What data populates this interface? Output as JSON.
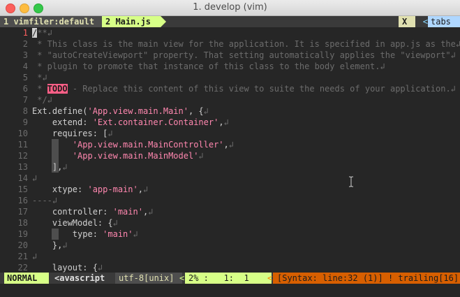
{
  "window": {
    "title": "1. develop (vim)"
  },
  "tabline": {
    "tab1": "1 vimfiler:default",
    "tab2": "2 Main.js",
    "close": "X",
    "sep": "<",
    "tabs": "tabs"
  },
  "editor": {
    "lines": [
      {
        "n": "1",
        "t": "/**↲"
      },
      {
        "n": "2",
        "t": " * This class is the main view for the application. It is specified in app.js as the↲"
      },
      {
        "n": "3",
        "t": " * \"autoCreateViewport\" property. That setting automatically applies the \"viewport\"↲"
      },
      {
        "n": "4",
        "t": " * plugin to promote that instance of this class to the body element.↲"
      },
      {
        "n": "5",
        "t": " *↲"
      },
      {
        "n": "6",
        "t": " * TODO - Replace this content of this view to suite the needs of your application.↲"
      },
      {
        "n": "7",
        "t": " */↲"
      },
      {
        "n": "8",
        "t": "Ext.define('App.view.main.Main', {↲"
      },
      {
        "n": "9",
        "t": "    extend: 'Ext.container.Container',↲"
      },
      {
        "n": "10",
        "t": "    requires: [↲"
      },
      {
        "n": "11",
        "t": "        'App.view.main.MainController',↲"
      },
      {
        "n": "12",
        "t": "        'App.view.main.MainModel'↲"
      },
      {
        "n": "13",
        "t": "    ],↲"
      },
      {
        "n": "14",
        "t": "↲"
      },
      {
        "n": "15",
        "t": "    xtype: 'app-main',↲"
      },
      {
        "n": "16",
        "t": "----↲"
      },
      {
        "n": "17",
        "t": "    controller: 'main',↲"
      },
      {
        "n": "18",
        "t": "    viewModel: {↲"
      },
      {
        "n": "19",
        "t": "        type: 'main'↲"
      },
      {
        "n": "20",
        "t": "    },↲"
      },
      {
        "n": "21",
        "t": "↲"
      },
      {
        "n": "22",
        "t": "    layout: {↲"
      }
    ],
    "todo": "TODO",
    "cursor_line": "1"
  },
  "statusline": {
    "mode": "NORMAL",
    "mode_arrow": ">",
    "filetype": "<avascript",
    "encoding": "utf-8[unix]",
    "enc_arrow": "<",
    "position": "2% :   1:  1",
    "pos_arrow": "<",
    "warning": "[Syntax: line:32 (1)] ! trailing[16]"
  },
  "colors": {
    "background": "#262626",
    "accent_green": "#d7ff87",
    "string_pink": "#ff87af",
    "todo_bg": "#ff5f87",
    "warning_orange": "#d75f00",
    "tabs_blue": "#afd7ff"
  }
}
